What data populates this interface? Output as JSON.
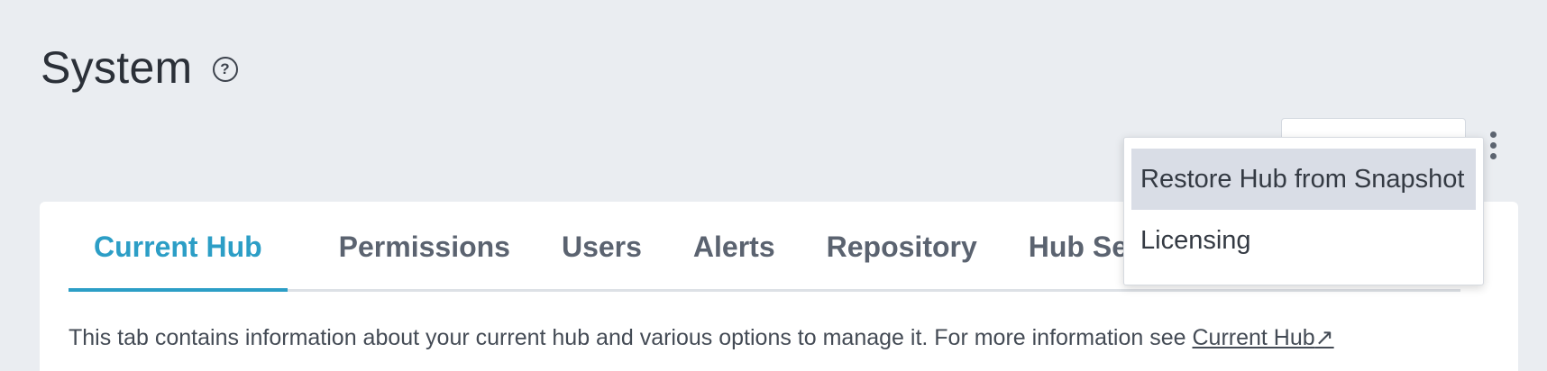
{
  "header": {
    "title": "System",
    "help_icon": "?"
  },
  "tabs": [
    {
      "label": "Current Hub",
      "active": true
    },
    {
      "label": "Permissions",
      "active": false
    },
    {
      "label": "Users",
      "active": false
    },
    {
      "label": "Alerts",
      "active": false
    },
    {
      "label": "Repository",
      "active": false
    },
    {
      "label": "Hub Serv",
      "active": false
    }
  ],
  "description": {
    "text": "This tab contains information about your current hub and various options to manage it. For more information see ",
    "link_label": "Current Hub",
    "link_icon": "↗"
  },
  "dropdown": {
    "items": [
      {
        "label": "Restore Hub from Snapshot"
      },
      {
        "label": "Licensing"
      }
    ]
  },
  "colors": {
    "accent": "#2c9ec6",
    "background": "#eaedf1",
    "menu_highlight": "#d9dde6"
  },
  "icons": {
    "help": "help-circle-icon",
    "kebab": "more-vertical-icon",
    "external_link": "external-link-icon"
  }
}
